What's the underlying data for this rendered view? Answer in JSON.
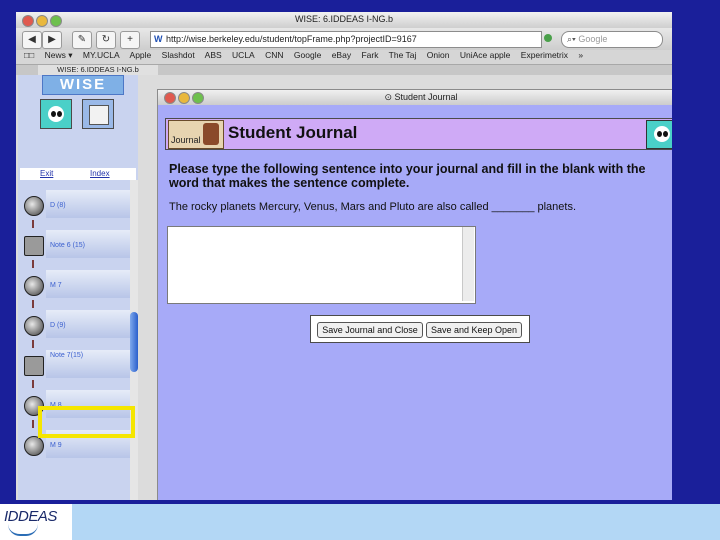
{
  "browser": {
    "window_title": "WISE: 6.IDDEAS I-NG.b",
    "url": "http://wise.berkeley.edu/student/topFrame.php?projectID=9167",
    "search_placeholder": "Google",
    "bookmarks": [
      "News ▾",
      "MY.UCLA",
      "Apple",
      "Slashdot",
      "ABS",
      "UCLA",
      "CNN",
      "Google",
      "eBay",
      "Fark",
      "The Taj",
      "Onion",
      "UniAce apple",
      "Experimetrix",
      "»"
    ],
    "tab_title": "WISE: 6.IDDEAS I-NG.b"
  },
  "wise": {
    "logo_text": "WISE",
    "nav": {
      "exit_label": "Exit",
      "index_label": "Index"
    },
    "steps": [
      {
        "label": "D (8)"
      },
      {
        "label": "Note 6 (15)"
      },
      {
        "label": "M 7"
      },
      {
        "label": "D (9)"
      },
      {
        "label": "Note 7(15)"
      },
      {
        "label": "M 8"
      },
      {
        "label": "M 9"
      }
    ]
  },
  "journal": {
    "window_title": "Student Journal",
    "icon_label": "Journal",
    "heading": "Student Journal",
    "instruction": "Please type the following sentence into your journal and fill in the blank with the word that makes the sentence complete.",
    "sentence": "The rocky planets Mercury, Venus, Mars and Pluto are also called _______ planets.",
    "entry_text": "",
    "buttons": {
      "save_close": "Save Journal and Close",
      "save_open": "Save and Keep Open"
    }
  },
  "footer": {
    "logo_text": "IDDEAS"
  },
  "colors": {
    "slide_blue": "#1a1f9a",
    "journal_bg": "#a7aaf8",
    "header_purple": "#cfaaf6",
    "highlight": "#f5e600",
    "footer_blue": "#b3d7f5"
  },
  "icons": [
    "panda-icon",
    "map-icon",
    "journal-icon",
    "globe-icon",
    "search-icon"
  ]
}
